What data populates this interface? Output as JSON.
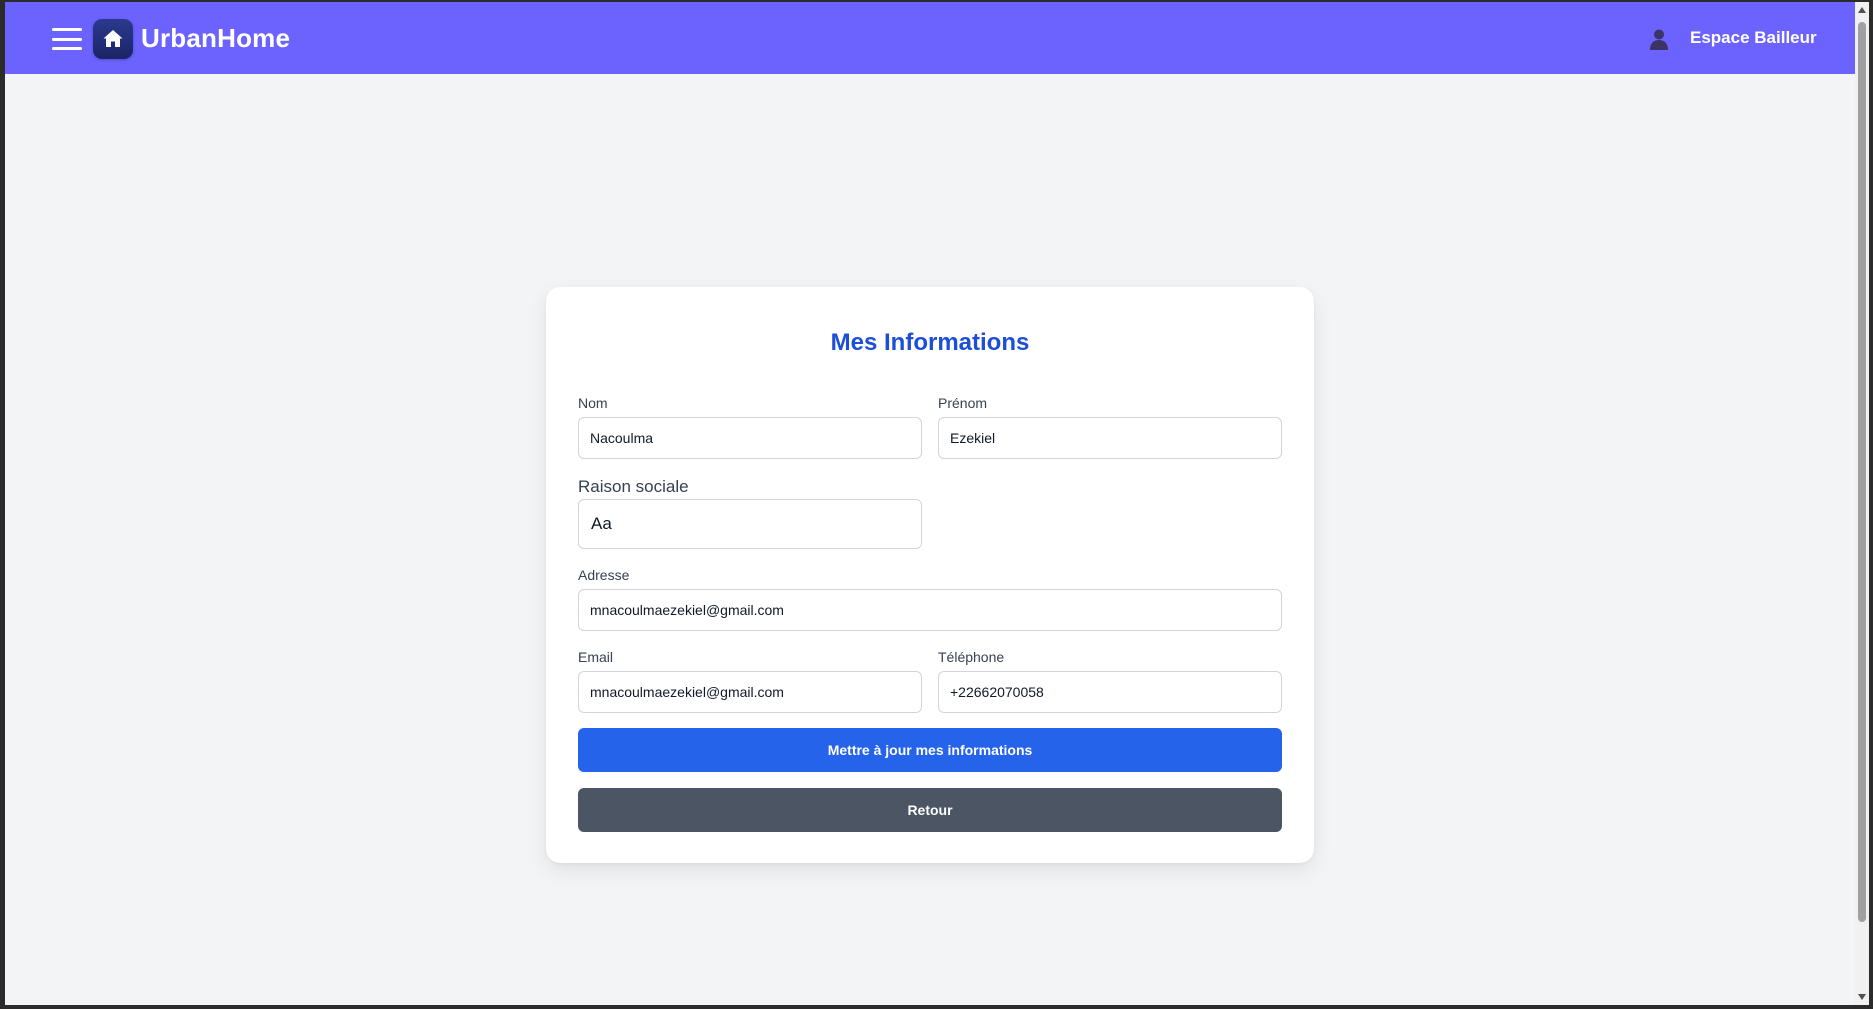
{
  "header": {
    "brand": "UrbanHome",
    "space_label": "Espace Bailleur",
    "bg_color": "#6c63ff"
  },
  "form": {
    "title": "Mes Informations",
    "nom": {
      "label": "Nom",
      "value": "Nacoulma"
    },
    "prenom": {
      "label": "Prénom",
      "value": "Ezekiel"
    },
    "raison_sociale": {
      "label": "Raison sociale",
      "value": "Aa"
    },
    "adresse": {
      "label": "Adresse",
      "value": "mnacoulmaezekiel@gmail.com"
    },
    "email": {
      "label": "Email",
      "value": "mnacoulmaezekiel@gmail.com"
    },
    "telephone": {
      "label": "Téléphone",
      "value": "+22662070058"
    },
    "update_button": "Mettre à jour mes informations",
    "back_button": "Retour"
  },
  "colors": {
    "primary": "#2563eb",
    "secondary": "#4b5563",
    "title": "#1d4ed8",
    "page_bg": "#f3f4f6"
  },
  "icons": {
    "menu": "hamburger-menu-icon",
    "logo": "home-icon",
    "user": "user-icon"
  }
}
